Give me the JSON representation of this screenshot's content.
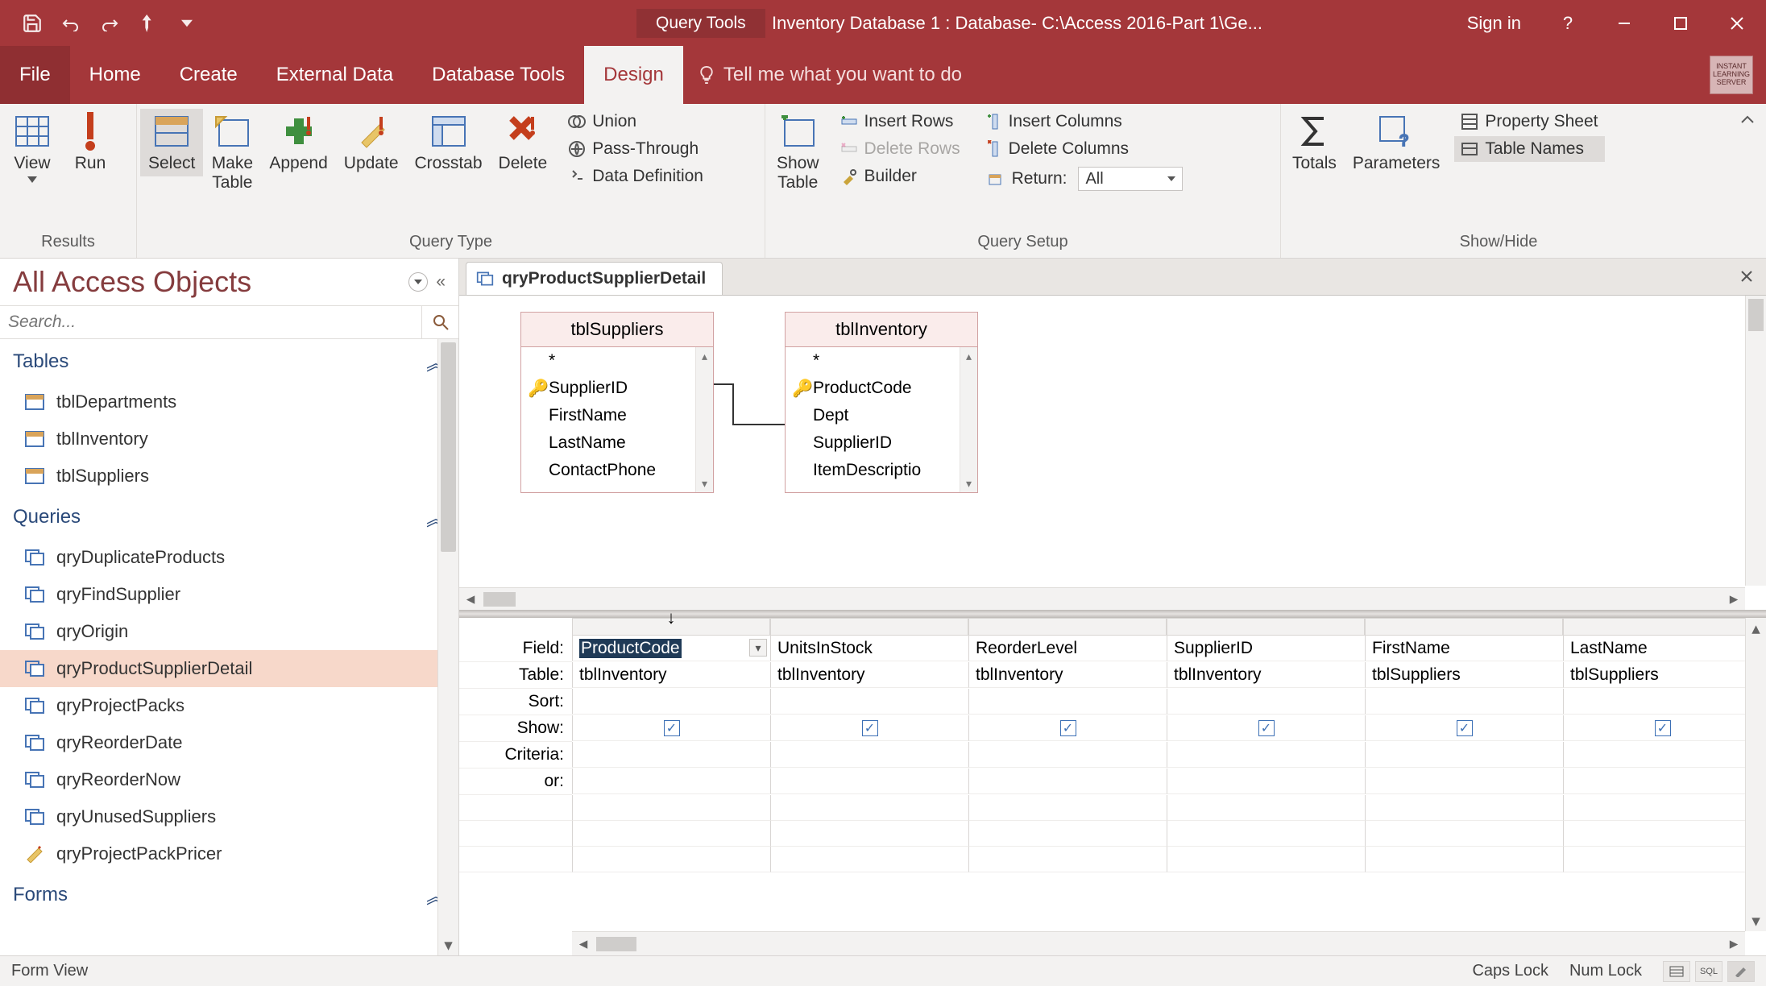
{
  "titlebar": {
    "context_tab": "Query Tools",
    "title": "Inventory Database 1 : Database- C:\\Access 2016-Part 1\\Ge...",
    "signin": "Sign in"
  },
  "tabs": {
    "file": "File",
    "home": "Home",
    "create": "Create",
    "external": "External Data",
    "dbtools": "Database Tools",
    "design": "Design",
    "tellme": "Tell me what you want to do"
  },
  "ribbon": {
    "results": {
      "label": "Results",
      "view": "View",
      "run": "Run"
    },
    "qtype": {
      "label": "Query Type",
      "select": "Select",
      "make": "Make\nTable",
      "append": "Append",
      "update": "Update",
      "crosstab": "Crosstab",
      "delete": "Delete",
      "union": "Union",
      "pass": "Pass-Through",
      "datadef": "Data Definition"
    },
    "qsetup": {
      "label": "Query Setup",
      "show": "Show\nTable",
      "insrows": "Insert Rows",
      "delrows": "Delete Rows",
      "builder": "Builder",
      "inscols": "Insert Columns",
      "delcols": "Delete Columns",
      "return": "Return:",
      "return_val": "All"
    },
    "showhide": {
      "label": "Show/Hide",
      "totals": "Totals",
      "params": "Parameters",
      "prop": "Property Sheet",
      "tnames": "Table Names"
    }
  },
  "nav": {
    "title": "All Access Objects",
    "search_ph": "Search...",
    "cats": {
      "tables": "Tables",
      "queries": "Queries",
      "forms": "Forms"
    },
    "tables": [
      "tblDepartments",
      "tblInventory",
      "tblSuppliers"
    ],
    "queries": [
      "qryDuplicateProducts",
      "qryFindSupplier",
      "qryOrigin",
      "qryProductSupplierDetail",
      "qryProjectPacks",
      "qryReorderDate",
      "qryReorderNow",
      "qryUnusedSuppliers",
      "qryProjectPackPricer"
    ]
  },
  "doc": {
    "tab": "qryProductSupplierDetail"
  },
  "tablesOnSurface": {
    "t1": {
      "name": "tblSuppliers",
      "fields": [
        "*",
        "SupplierID",
        "FirstName",
        "LastName",
        "ContactPhone"
      ],
      "key_index": 1
    },
    "t2": {
      "name": "tblInventory",
      "fields": [
        "*",
        "ProductCode",
        "Dept",
        "SupplierID",
        "ItemDescriptio"
      ],
      "key_index": 1
    }
  },
  "grid": {
    "rows": [
      "Field:",
      "Table:",
      "Sort:",
      "Show:",
      "Criteria:",
      "or:"
    ],
    "cols": [
      {
        "field": "ProductCode",
        "table": "tblInventory",
        "show": true
      },
      {
        "field": "UnitsInStock",
        "table": "tblInventory",
        "show": true
      },
      {
        "field": "ReorderLevel",
        "table": "tblInventory",
        "show": true
      },
      {
        "field": "SupplierID",
        "table": "tblInventory",
        "show": true
      },
      {
        "field": "FirstName",
        "table": "tblSuppliers",
        "show": true
      },
      {
        "field": "LastName",
        "table": "tblSuppliers",
        "show": true
      }
    ]
  },
  "status": {
    "left": "Form View",
    "caps": "Caps Lock",
    "num": "Num Lock"
  }
}
